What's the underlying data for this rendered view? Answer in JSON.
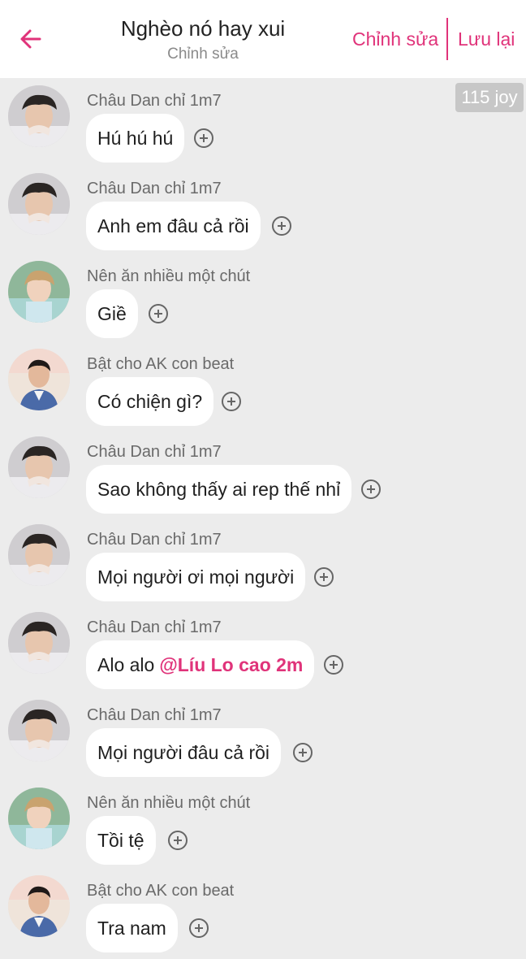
{
  "header": {
    "title": "Nghèo nó hay xui",
    "subtitle": "Chỉnh sửa",
    "edit_label": "Chỉnh sửa",
    "save_label": "Lưu lại",
    "back_icon": "back-arrow-icon",
    "accent_color": "#e0337a"
  },
  "joy_badge": "115 joy",
  "messages": [
    {
      "sender": "Châu Dan chỉ 1m7",
      "text": "Hú hú hú",
      "mention": "",
      "avatar": "avatar-a"
    },
    {
      "sender": "Châu Dan chỉ 1m7",
      "text": "Anh em đâu cả rồi",
      "mention": "",
      "avatar": "avatar-a"
    },
    {
      "sender": "Nên ăn nhiều một chút",
      "text": "Giề",
      "mention": "",
      "avatar": "avatar-b"
    },
    {
      "sender": "Bật cho AK con beat",
      "text": "Có chiện gì?",
      "mention": "",
      "avatar": "avatar-c"
    },
    {
      "sender": "Châu Dan chỉ 1m7",
      "text": "Sao không thấy ai rep thế nhỉ",
      "mention": "",
      "avatar": "avatar-a"
    },
    {
      "sender": "Châu Dan chỉ 1m7",
      "text": "Mọi người ơi mọi người",
      "mention": "",
      "avatar": "avatar-a"
    },
    {
      "sender": "Châu Dan chỉ 1m7",
      "text": "Alo alo",
      "mention": "@Líu Lo cao 2m",
      "avatar": "avatar-a"
    },
    {
      "sender": "Châu Dan chỉ 1m7",
      "text": "Mọi người đâu cả rồi",
      "mention": "",
      "avatar": "avatar-a"
    },
    {
      "sender": "Nên ăn nhiều một chút",
      "text": "Tồi tệ",
      "mention": "",
      "avatar": "avatar-b"
    },
    {
      "sender": "Bật cho AK con beat",
      "text": "Tra nam",
      "mention": "",
      "avatar": "avatar-c"
    }
  ]
}
